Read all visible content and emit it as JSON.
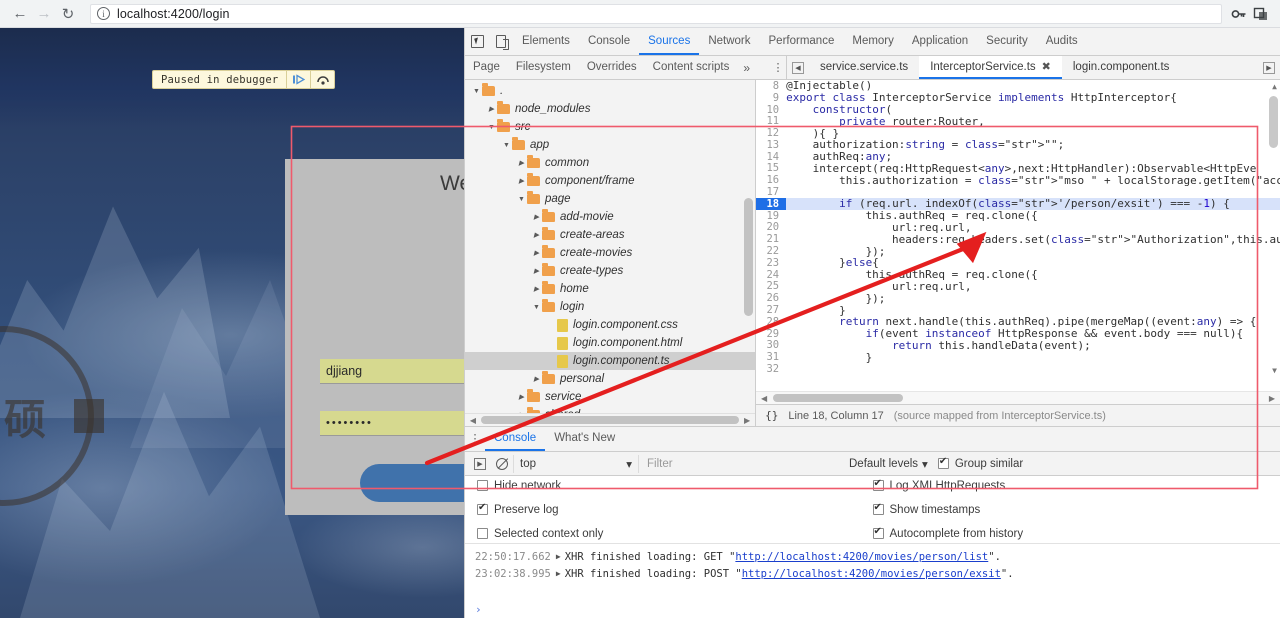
{
  "browser": {
    "back_icon": "arrow-left-icon",
    "forward_icon": "arrow-right-icon",
    "reload_icon": "reload-icon",
    "info_icon": "ⓘ",
    "url": "localhost:4200/login",
    "key_icon": "key-icon",
    "extension_icon": "extension-icon"
  },
  "page": {
    "pause_banner": {
      "label": "Paused in debugger",
      "resume_icon": "resume-icon",
      "step_over_icon": "step-over-icon"
    },
    "login": {
      "title": "We",
      "username_value": "djjiang",
      "password_value": "••••••••",
      "submit_label": ""
    },
    "watermark_glyph": "硕"
  },
  "devtools": {
    "inspect_icon": "inspect-element-icon",
    "device_icon": "device-toolbar-icon",
    "tabs": [
      {
        "label": "Elements",
        "active": false
      },
      {
        "label": "Console",
        "active": false
      },
      {
        "label": "Sources",
        "active": true
      },
      {
        "label": "Network",
        "active": false
      },
      {
        "label": "Performance",
        "active": false
      },
      {
        "label": "Memory",
        "active": false
      },
      {
        "label": "Application",
        "active": false
      },
      {
        "label": "Security",
        "active": false
      },
      {
        "label": "Audits",
        "active": false
      }
    ],
    "nav_subtabs": [
      {
        "label": "Page",
        "active": false
      },
      {
        "label": "Filesystem",
        "active": false
      },
      {
        "label": "Overrides",
        "active": false
      },
      {
        "label": "Content scripts",
        "active": false
      }
    ],
    "nav_more": "»",
    "nav_kebab": "⋮",
    "file_tabs": [
      {
        "label": "service.service.ts",
        "active": false,
        "closable": false
      },
      {
        "label": "InterceptorService.ts",
        "active": true,
        "closable": true,
        "close_icon": "✖"
      },
      {
        "label": "login.component.ts",
        "active": false,
        "closable": false
      }
    ],
    "tab_scroll_left_icon": "◀",
    "tab_scroll_right_icon": "▶",
    "tree": [
      {
        "indent": 0,
        "twisty": "▼",
        "type": "folder",
        "label": "."
      },
      {
        "indent": 1,
        "twisty": "▶",
        "type": "folder",
        "label": "node_modules"
      },
      {
        "indent": 1,
        "twisty": "▼",
        "type": "folder",
        "label": "src"
      },
      {
        "indent": 2,
        "twisty": "▼",
        "type": "folder",
        "label": "app"
      },
      {
        "indent": 3,
        "twisty": "▶",
        "type": "folder",
        "label": "common"
      },
      {
        "indent": 3,
        "twisty": "▶",
        "type": "folder",
        "label": "component/frame"
      },
      {
        "indent": 3,
        "twisty": "▼",
        "type": "folder",
        "label": "page"
      },
      {
        "indent": 4,
        "twisty": "▶",
        "type": "folder",
        "label": "add-movie"
      },
      {
        "indent": 4,
        "twisty": "▶",
        "type": "folder",
        "label": "create-areas"
      },
      {
        "indent": 4,
        "twisty": "▶",
        "type": "folder",
        "label": "create-movies"
      },
      {
        "indent": 4,
        "twisty": "▶",
        "type": "folder",
        "label": "create-types"
      },
      {
        "indent": 4,
        "twisty": "▶",
        "type": "folder",
        "label": "home"
      },
      {
        "indent": 4,
        "twisty": "▼",
        "type": "folder",
        "label": "login"
      },
      {
        "indent": 5,
        "twisty": "",
        "type": "file",
        "label": "login.component.css"
      },
      {
        "indent": 5,
        "twisty": "",
        "type": "file",
        "label": "login.component.html"
      },
      {
        "indent": 5,
        "twisty": "",
        "type": "file",
        "label": "login.component.ts",
        "selected": true
      },
      {
        "indent": 4,
        "twisty": "▶",
        "type": "folder",
        "label": "personal"
      },
      {
        "indent": 3,
        "twisty": "▶",
        "type": "folder",
        "label": "service"
      },
      {
        "indent": 3,
        "twisty": "▶",
        "type": "folder",
        "label": "shared"
      }
    ],
    "code": [
      {
        "n": 8,
        "text": "@Injectable()"
      },
      {
        "n": 9,
        "text": "export class InterceptorService implements HttpInterceptor{"
      },
      {
        "n": 10,
        "text": "    constructor("
      },
      {
        "n": 11,
        "text": "        private router:Router,"
      },
      {
        "n": 12,
        "text": "    ){ }"
      },
      {
        "n": 13,
        "text": "    authorization:string = \"\";"
      },
      {
        "n": 14,
        "text": "    authReq:any;"
      },
      {
        "n": 15,
        "text": "    intercept(req:HttpRequest<any>,next:HttpHandler):Observable<HttpEve"
      },
      {
        "n": 16,
        "text": "        this.authorization = \"mso \" + localStorage.getItem(\"accessToken"
      },
      {
        "n": 17,
        "text": ""
      },
      {
        "n": 18,
        "text": "        if (req.url. indexOf('/person/exsit') === -1) {",
        "highlighted": true
      },
      {
        "n": 19,
        "text": "            this.authReq = req.clone({"
      },
      {
        "n": 20,
        "text": "                url:req.url,"
      },
      {
        "n": 21,
        "text": "                headers:req.headers.set(\"Authorization\",this.authorizat"
      },
      {
        "n": 22,
        "text": "            });"
      },
      {
        "n": 23,
        "text": "        }else{"
      },
      {
        "n": 24,
        "text": "            this.authReq = req.clone({"
      },
      {
        "n": 25,
        "text": "                url:req.url,"
      },
      {
        "n": 26,
        "text": "            });"
      },
      {
        "n": 27,
        "text": "        }"
      },
      {
        "n": 28,
        "text": "        return next.handle(this.authReq).pipe(mergeMap((event:any) => {"
      },
      {
        "n": 29,
        "text": "            if(event instanceof HttpResponse && event.body === null){"
      },
      {
        "n": 30,
        "text": "                return this.handleData(event);"
      },
      {
        "n": 31,
        "text": "            }"
      },
      {
        "n": 32,
        "text": ""
      }
    ],
    "editor_status": {
      "format_icon": "{}",
      "position": "Line 18, Column 17",
      "source_map": "(source mapped from InterceptorService.ts)"
    },
    "drawer": {
      "kebab": "⋮",
      "tabs": [
        {
          "label": "Console",
          "active": true
        },
        {
          "label": "What's New",
          "active": false
        }
      ],
      "execute_icon": "execution-context-icon",
      "clear_icon": "clear-console-icon",
      "context": "top",
      "context_caret": "▾",
      "filter_placeholder": "Filter",
      "levels_label": "Default levels",
      "levels_caret": "▾",
      "group_similar": {
        "label": "Group similar",
        "checked": true
      },
      "settings": [
        {
          "label": "Hide network",
          "checked": false
        },
        {
          "label": "Log XMLHttpRequests",
          "checked": true
        },
        {
          "label": "Preserve log",
          "checked": true
        },
        {
          "label": "Show timestamps",
          "checked": true
        },
        {
          "label": "Selected context only",
          "checked": false
        },
        {
          "label": "Autocomplete from history",
          "checked": true
        }
      ],
      "messages": [
        {
          "timestamp": "22:50:17.662",
          "arrow": "▶",
          "text": "XHR finished loading: GET ",
          "link": "http://localhost:4200/movies/person/list",
          "suffix": "."
        },
        {
          "timestamp": "23:02:38.995",
          "arrow": "▶",
          "text": "XHR finished loading: POST ",
          "link": "http://localhost:4200/movies/person/exsit",
          "suffix": "."
        }
      ],
      "prompt": "›"
    }
  },
  "annotations": {
    "highlight_rect_color": "#e8455a",
    "arrow_color": "#e02020"
  }
}
